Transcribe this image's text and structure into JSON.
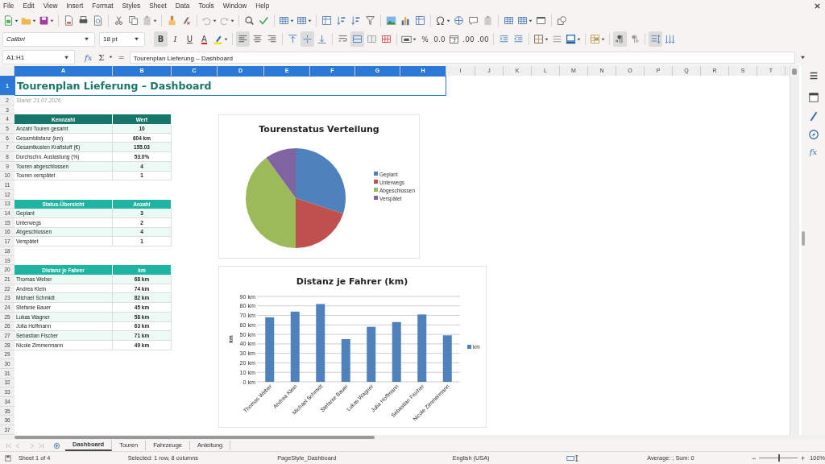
{
  "menu": [
    "File",
    "Edit",
    "View",
    "Insert",
    "Format",
    "Styles",
    "Sheet",
    "Data",
    "Tools",
    "Window",
    "Help"
  ],
  "formatting": {
    "font_name": "Calibri",
    "font_size": "18 pt",
    "styles": [
      {
        "label": "B",
        "selected": true
      },
      {
        "label": "I",
        "selected": false
      },
      {
        "label": "U",
        "selected": false
      }
    ],
    "font_color_label": "A",
    "align": [
      {
        "kind": "left",
        "selected": true
      },
      {
        "kind": "center",
        "selected": false
      },
      {
        "kind": "right",
        "selected": false
      }
    ],
    "valign": [
      {
        "kind": "top",
        "selected": false
      },
      {
        "kind": "middle",
        "selected": true
      },
      {
        "kind": "bottom",
        "selected": false
      }
    ],
    "merge": [
      {
        "kind": "wrap",
        "selected": false
      },
      {
        "kind": "merge",
        "selected": true
      },
      {
        "kind": "unmerge",
        "selected": false
      },
      {
        "kind": "split",
        "selected": false
      }
    ],
    "number_formats": [
      "%",
      "0.0",
      ".00",
      ".00"
    ],
    "text_direction": [
      {
        "kind": "ltr",
        "selected": true
      },
      {
        "kind": "rtl",
        "selected": false
      }
    ],
    "spacing": [
      {
        "kind": "paragraph",
        "selected": true
      },
      {
        "kind": "sort",
        "selected": false
      }
    ]
  },
  "formula_bar": {
    "name_box": "A1:H1",
    "function_label": "fx",
    "sum_label": "Σ",
    "equals_label": "=",
    "value": "Tourenplan Lieferung – Dashboard"
  },
  "columns": [
    {
      "label": "A",
      "selected": true
    },
    {
      "label": "B",
      "selected": true
    },
    {
      "label": "C",
      "selected": true
    },
    {
      "label": "D",
      "selected": true
    },
    {
      "label": "E",
      "selected": true
    },
    {
      "label": "F",
      "selected": true
    },
    {
      "label": "G",
      "selected": true
    },
    {
      "label": "H",
      "selected": true
    },
    {
      "label": "I",
      "selected": false
    },
    {
      "label": "J",
      "selected": false
    },
    {
      "label": "K",
      "selected": false
    },
    {
      "label": "L",
      "selected": false
    },
    {
      "label": "M",
      "selected": false
    },
    {
      "label": "N",
      "selected": false
    },
    {
      "label": "O",
      "selected": false
    },
    {
      "label": "P",
      "selected": false
    },
    {
      "label": "Q",
      "selected": false
    },
    {
      "label": "R",
      "selected": false
    },
    {
      "label": "S",
      "selected": false
    },
    {
      "label": "T",
      "selected": false
    }
  ],
  "rows": [
    {
      "number": "1",
      "selected": true,
      "kind": "title",
      "cells": [
        "Tourenplan Lieferung – Dashboard"
      ]
    },
    {
      "number": "2",
      "selected": false,
      "kind": "note",
      "cells": [
        "Stand: 21.07.2026"
      ]
    },
    {
      "number": "3",
      "selected": false,
      "kind": "empty"
    },
    {
      "number": "4",
      "selected": false,
      "kind": "header",
      "color": "#17766a",
      "cells": [
        "Kennzahl",
        "Wert"
      ]
    },
    {
      "number": "5",
      "selected": false,
      "kind": "data",
      "cells": [
        "Anzahl Touren gesamt",
        "10"
      ]
    },
    {
      "number": "6",
      "selected": false,
      "kind": "data",
      "cells": [
        "Gesamtdistanz (km)",
        "604 km"
      ]
    },
    {
      "number": "7",
      "selected": false,
      "kind": "data",
      "cells": [
        "Gesamtkosten Kraftstoff (€)",
        "155.03"
      ]
    },
    {
      "number": "8",
      "selected": false,
      "kind": "data",
      "cells": [
        "Durchschn. Auslastung (%)",
        "53.0%"
      ]
    },
    {
      "number": "9",
      "selected": false,
      "kind": "data",
      "cells": [
        "Touren abgeschlossen",
        "4"
      ]
    },
    {
      "number": "10",
      "selected": false,
      "kind": "data",
      "cells": [
        "Touren verspätet",
        "1"
      ]
    },
    {
      "number": "11",
      "selected": false,
      "kind": "empty"
    },
    {
      "number": "12",
      "selected": false,
      "kind": "empty"
    },
    {
      "number": "13",
      "selected": false,
      "kind": "header",
      "color": "#1db5a2",
      "cells": [
        "Status-Übersicht",
        "Anzahl"
      ]
    },
    {
      "number": "14",
      "selected": false,
      "kind": "data",
      "cells": [
        "Geplant",
        "3"
      ]
    },
    {
      "number": "15",
      "selected": false,
      "kind": "data",
      "cells": [
        "Unterwegs",
        "2"
      ]
    },
    {
      "number": "16",
      "selected": false,
      "kind": "data",
      "cells": [
        "Abgeschlossen",
        "4"
      ]
    },
    {
      "number": "17",
      "selected": false,
      "kind": "data",
      "cells": [
        "Verspätet",
        "1"
      ]
    },
    {
      "number": "18",
      "selected": false,
      "kind": "empty"
    },
    {
      "number": "19",
      "selected": false,
      "kind": "empty"
    },
    {
      "number": "20",
      "selected": false,
      "kind": "header",
      "color": "#1db5a2",
      "cells": [
        "Distanz je Fahrer",
        "km"
      ]
    },
    {
      "number": "21",
      "selected": false,
      "kind": "data",
      "cells": [
        "Thomas Weber",
        "68 km"
      ]
    },
    {
      "number": "22",
      "selected": false,
      "kind": "data",
      "cells": [
        "Andrea Klein",
        "74 km"
      ]
    },
    {
      "number": "23",
      "selected": false,
      "kind": "data",
      "cells": [
        "Michael Schmidt",
        "82 km"
      ]
    },
    {
      "number": "24",
      "selected": false,
      "kind": "data",
      "cells": [
        "Stefanie Bauer",
        "45 km"
      ]
    },
    {
      "number": "25",
      "selected": false,
      "kind": "data",
      "cells": [
        "Lukas Wagner",
        "58 km"
      ]
    },
    {
      "number": "26",
      "selected": false,
      "kind": "data",
      "cells": [
        "Julia Hoffmann",
        "63 km"
      ]
    },
    {
      "number": "27",
      "selected": false,
      "kind": "data",
      "cells": [
        "Sebastian Fischer",
        "71 km"
      ]
    },
    {
      "number": "28",
      "selected": false,
      "kind": "data",
      "cells": [
        "Nicole Zimmermann",
        "49 km"
      ]
    },
    {
      "number": "29",
      "selected": false,
      "kind": "empty"
    },
    {
      "number": "30",
      "selected": false,
      "kind": "empty"
    },
    {
      "number": "31",
      "selected": false,
      "kind": "empty"
    },
    {
      "number": "32",
      "selected": false,
      "kind": "empty"
    },
    {
      "number": "33",
      "selected": false,
      "kind": "empty"
    },
    {
      "number": "34",
      "selected": false,
      "kind": "empty"
    },
    {
      "number": "35",
      "selected": false,
      "kind": "empty"
    },
    {
      "number": "36",
      "selected": false,
      "kind": "empty"
    },
    {
      "number": "37",
      "selected": false,
      "kind": "empty"
    }
  ],
  "pie_chart": {
    "chart_data": {
      "type": "pie",
      "title": "Tourenstatus Verteilung",
      "categories": [
        "Geplant",
        "Unterwegs",
        "Abgeschlossen",
        "Verspätet"
      ],
      "values": [
        30,
        20,
        40,
        10
      ],
      "legend": "right"
    }
  },
  "bar_chart": {
    "chart_data": {
      "type": "bar",
      "title": "Distanz je Fahrer (km)",
      "ylabel": "km",
      "categories": [
        "Thomas Weber",
        "Andrea Klein",
        "Michael Schmidt",
        "Stefanie Bauer",
        "Lukas Wagner",
        "Julia Hoffmann",
        "Sebastian Fischer",
        "Nicole Zimmermann"
      ],
      "series": [
        {
          "name": "km",
          "color": "#4f81bd",
          "values": [
            68,
            74,
            82,
            45,
            58,
            63,
            71,
            49
          ]
        }
      ],
      "legend": "right",
      "grid": true,
      "ylim": [
        0,
        90
      ],
      "yticks": [
        {
          "value": 0,
          "label": "0 km"
        },
        {
          "value": 10,
          "label": "10 km"
        },
        {
          "value": 20,
          "label": "20 km"
        },
        {
          "value": 30,
          "label": "30 km"
        },
        {
          "value": 40,
          "label": "40 km"
        },
        {
          "value": 50,
          "label": "50 km"
        },
        {
          "value": 60,
          "label": "60 km"
        },
        {
          "value": 70,
          "label": "70 km"
        },
        {
          "value": 80,
          "label": "80 km"
        },
        {
          "value": 90,
          "label": "90 km"
        }
      ]
    }
  },
  "sheet_tabs": [
    {
      "label": "Dashboard",
      "selected": true
    },
    {
      "label": "Touren",
      "selected": false
    },
    {
      "label": "Fahrzeuge",
      "selected": false
    },
    {
      "label": "Anleitung",
      "selected": false
    }
  ],
  "status_bar": {
    "sheet": "Sheet 1 of 4",
    "selection": "Selected: 1 row, 8 columns",
    "page_style": "PageStyle_Dashboard",
    "language": "English (USA)",
    "summary": "Average: ; Sum: 0",
    "zoom_minus": "−",
    "zoom_plus": "+",
    "zoom": {
      "level": 0.5,
      "value": "100%"
    }
  },
  "sidebar_function_label": "fx"
}
